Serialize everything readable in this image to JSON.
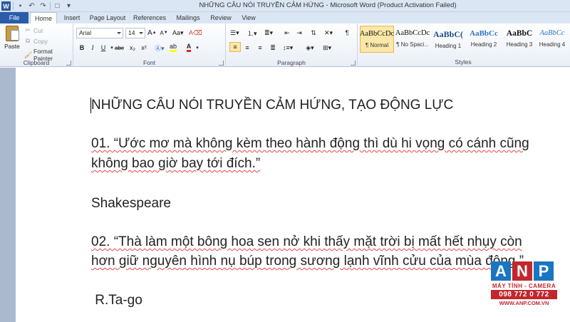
{
  "window": {
    "title": "NHỮNG CÂU NÓI TRUYỀN CẢM HỨNG  -  Microsoft Word (Product Activation Failed)",
    "app_icon": "W"
  },
  "tabs": [
    "File",
    "Home",
    "Insert",
    "Page Layout",
    "References",
    "Mailings",
    "Review",
    "View"
  ],
  "clipboard": {
    "paste": "Paste",
    "cut": "Cut",
    "copy": "Copy",
    "format_painter": "Format Painter",
    "label": "Clipboard"
  },
  "font": {
    "name": "Arial",
    "size": "14",
    "grow": "A",
    "shrink": "A",
    "bold": "B",
    "italic": "I",
    "underline": "U",
    "strike": "abc",
    "subscript": "x₂",
    "superscript": "x²",
    "color_letter": "A",
    "label": "Font"
  },
  "paragraph": {
    "label": "Paragraph",
    "pilcrow": "¶"
  },
  "styles": {
    "label": "Styles",
    "items": [
      {
        "sample": "AaBbCcDc",
        "name": "¶ Normal"
      },
      {
        "sample": "AaBbCcDc",
        "name": "¶ No Spaci..."
      },
      {
        "sample": "AaBbC(",
        "name": "Heading 1"
      },
      {
        "sample": "AaBbCc",
        "name": "Heading 2"
      },
      {
        "sample": "AaBbC",
        "name": "Heading 3"
      },
      {
        "sample": "AaBbCc",
        "name": "Heading 4"
      }
    ]
  },
  "document": {
    "title": "NHỮNG CÂU NÓI TRUYỀN CẢM HỨNG, TẠO ĐỘNG LỰC",
    "q1_line1": "01. “Ước mơ mà không kèm theo hành động thì dù hi vọng có cánh cũng",
    "q1_line2": "không bao giờ bay tới đích.”",
    "author1": "Shakespeare",
    "q2_line1": "02. “Thà làm một bông hoa sen nở khi thấy mặt trời bị mất hết nhụy còn",
    "q2_line2": "hơn giữ nguyên hình nụ búp trong sương lạnh vĩnh cửu của mùa đông.”",
    "author2": " R.Ta-go"
  },
  "watermark": {
    "letters": [
      "A",
      "N",
      "P"
    ],
    "tagline": "MÁY TÍNH - CAMERA",
    "phone": "098 772 0 772",
    "website": "WWW.ANP.COM.VN",
    "colors": {
      "blue": "#1a75c2",
      "red": "#c1272d"
    }
  },
  "colors": {
    "file_tab": "#2a5caa",
    "ribbon_bg": "#e9eef6",
    "doc_background": "#abb9cf",
    "selected_style": "#fbe7a7",
    "font_color_bar": "#e02020",
    "highlight_bar": "#ffff00"
  }
}
